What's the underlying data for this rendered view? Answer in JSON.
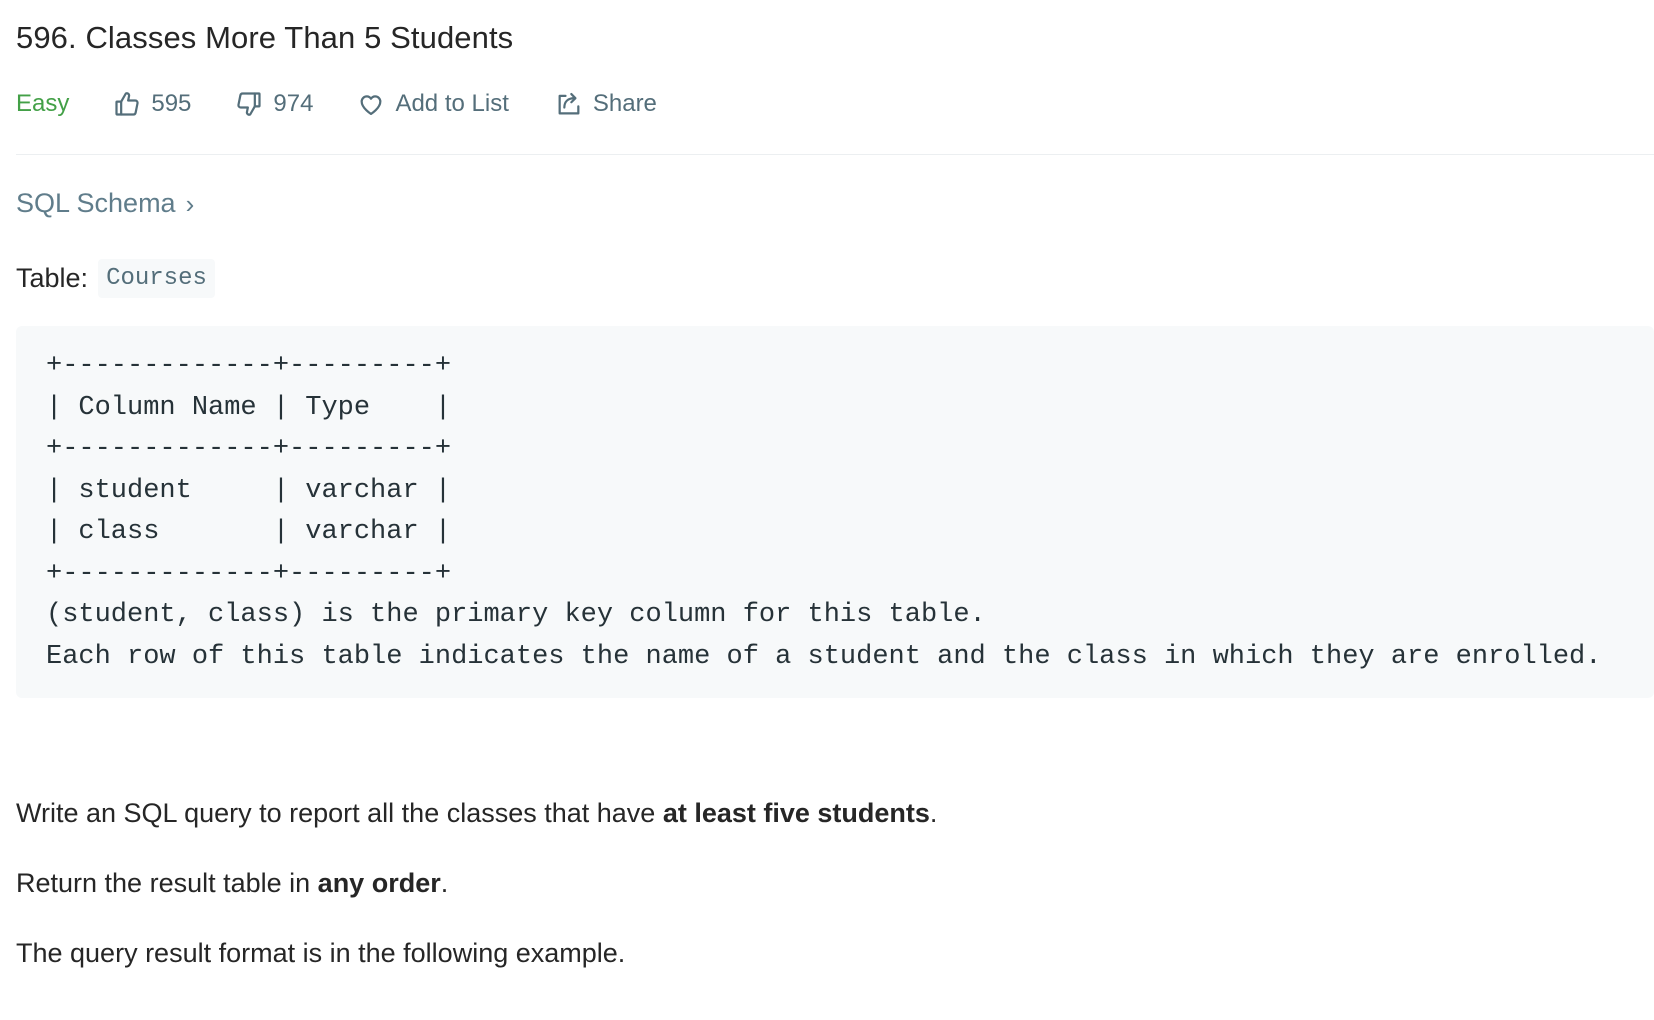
{
  "problem": {
    "title": "596. Classes More Than 5 Students",
    "difficulty": "Easy",
    "likes": "595",
    "dislikes": "974",
    "add_to_list_label": "Add to List",
    "share_label": "Share"
  },
  "schema": {
    "link_label": "SQL Schema",
    "chevron": "›"
  },
  "table_intro": {
    "label": "Table:",
    "table_name": "Courses"
  },
  "code_block": "+-------------+---------+\n| Column Name | Type    |\n+-------------+---------+\n| student     | varchar |\n| class       | varchar |\n+-------------+---------+\n(student, class) is the primary key column for this table.\nEach row of this table indicates the name of a student and the class in which they are enrolled.",
  "description": {
    "p1_before": "Write an SQL query to report all the classes that have ",
    "p1_bold": "at least five students",
    "p1_after": ".",
    "p2_before": "Return the result table in ",
    "p2_bold": "any order",
    "p2_after": ".",
    "p3": "The query result format is in the following example."
  },
  "colors": {
    "difficulty_easy": "#43a047",
    "meta_text": "#546e7a",
    "code_bg": "#f7f9fa"
  },
  "icons": [
    "thumbs-up-icon",
    "thumbs-down-icon",
    "heart-icon",
    "share-icon",
    "chevron-right-icon"
  ]
}
